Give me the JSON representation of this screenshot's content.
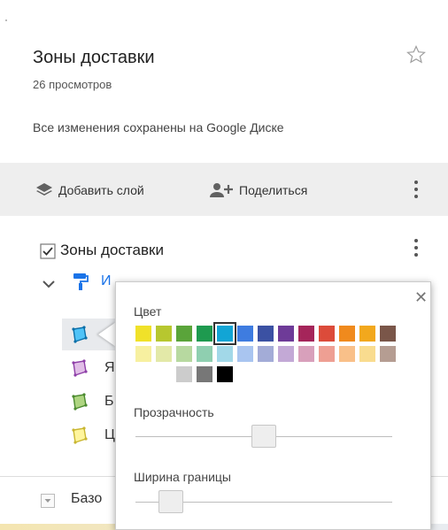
{
  "map": {
    "title": "Зоны доставки",
    "views": "26 просмотров",
    "save_status": "Все изменения сохранены на Google Диске"
  },
  "toolbar": {
    "add_layer": "Добавить слой",
    "share": "Поделиться"
  },
  "layer": {
    "name": "Зоны доставки",
    "checked": true,
    "sublayer_label": "И",
    "items": [
      {
        "text": "",
        "color": "#4fc3f7"
      },
      {
        "text": "Я",
        "color": "#ba68c8"
      },
      {
        "text": "Б",
        "color": "#7cb342"
      },
      {
        "text": "Ц",
        "color": "#f4e04d"
      }
    ]
  },
  "base_map": {
    "label": "Базо"
  },
  "style_panel": {
    "color_label": "Цвет",
    "opacity_label": "Прозрачность",
    "border_width_label": "Ширина границы",
    "opacity_value": 0.5,
    "border_width_value": 0.1,
    "selected_color": "#12a5d5",
    "palette_row1": [
      "#f0e129",
      "#b7c72f",
      "#5aa43a",
      "#1e9a4f",
      "#12a5d5",
      "#3e7ce0",
      "#3b51a3",
      "#6e3b98",
      "#a5255a",
      "#dc4b3a",
      "#f08a1d",
      "#f2a81d",
      "#7a5649"
    ],
    "palette_row2": [
      "#f7f0a0",
      "#e3e9a8",
      "#b7d9a0",
      "#8fcfb0",
      "#a2d8e8",
      "#a9c5f0",
      "#a3acd7",
      "#c3a9d6",
      "#d8a0bb",
      "#ee9f93",
      "#f9c089",
      "#f9dc8f",
      "#b59d92"
    ],
    "palette_row3": [
      "#ffffff",
      "#cccccc",
      "#777777",
      "#000000"
    ]
  }
}
